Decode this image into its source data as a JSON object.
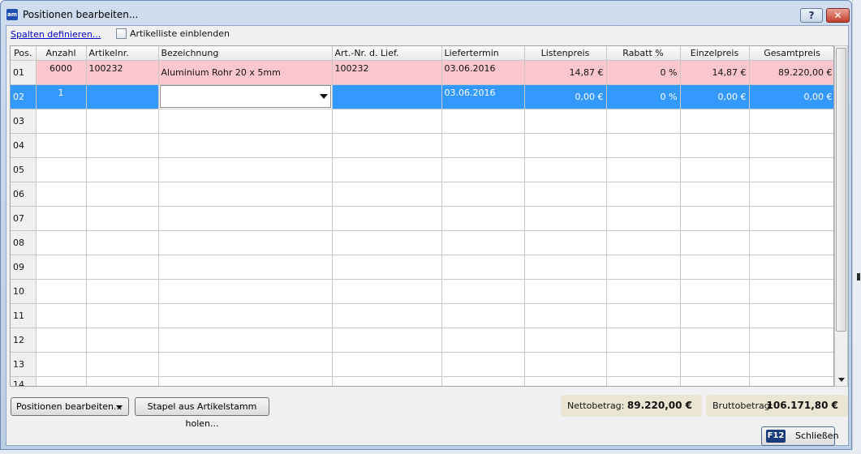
{
  "window": {
    "title": "Positionen bearbeiten...",
    "app_icon": "am",
    "help_label": "?",
    "close_label": "✕"
  },
  "toolbar": {
    "define_columns_link": "Spalten definieren...",
    "show_article_list_label": "Artikelliste einblenden",
    "show_article_list_checked": false
  },
  "grid": {
    "columns": [
      "Pos.",
      "Anzahl",
      "Artikelnr.",
      "Bezeichnung",
      "Art.-Nr. d. Lief.",
      "Liefertermin",
      "Listenpreis",
      "Rabatt %",
      "Einzelpreis",
      "Gesamtpreis"
    ],
    "rows": [
      {
        "pos": "01",
        "anzahl": "6000",
        "artikelnr": "100232",
        "bezeichnung": "Aluminium Rohr 20 x 5mm",
        "art_lief": "100232",
        "liefertermin": "03.06.2016",
        "listenpreis": "14,87 €",
        "rabatt": "0 %",
        "einzelpreis": "14,87 €",
        "gesamtpreis": "89.220,00 €"
      },
      {
        "pos": "02",
        "anzahl": "1",
        "artikelnr": "",
        "bezeichnung": "",
        "art_lief": "",
        "liefertermin": "03.06.2016",
        "listenpreis": "0,00 €",
        "rabatt": "0 %",
        "einzelpreis": "0,00 €",
        "gesamtpreis": "0,00 €"
      },
      {
        "pos": "03"
      },
      {
        "pos": "04"
      },
      {
        "pos": "05"
      },
      {
        "pos": "06"
      },
      {
        "pos": "07"
      },
      {
        "pos": "08"
      },
      {
        "pos": "09"
      },
      {
        "pos": "10"
      },
      {
        "pos": "11"
      },
      {
        "pos": "12"
      },
      {
        "pos": "13"
      },
      {
        "pos": "14"
      }
    ],
    "colors": {
      "row_highlight": "#fcc6cd",
      "row_selected": "#3399ff"
    }
  },
  "footer": {
    "positions_button": "Positionen bearbeiten...",
    "stapel_button": "Stapel aus Artikelstamm holen...",
    "netto_label": "Nettobetrag:",
    "netto_value": "89.220,00 €",
    "brutto_label": "Bruttobetrag:",
    "brutto_value": "106.171,80 €",
    "close_key": "F12",
    "close_button": "Schließen"
  }
}
